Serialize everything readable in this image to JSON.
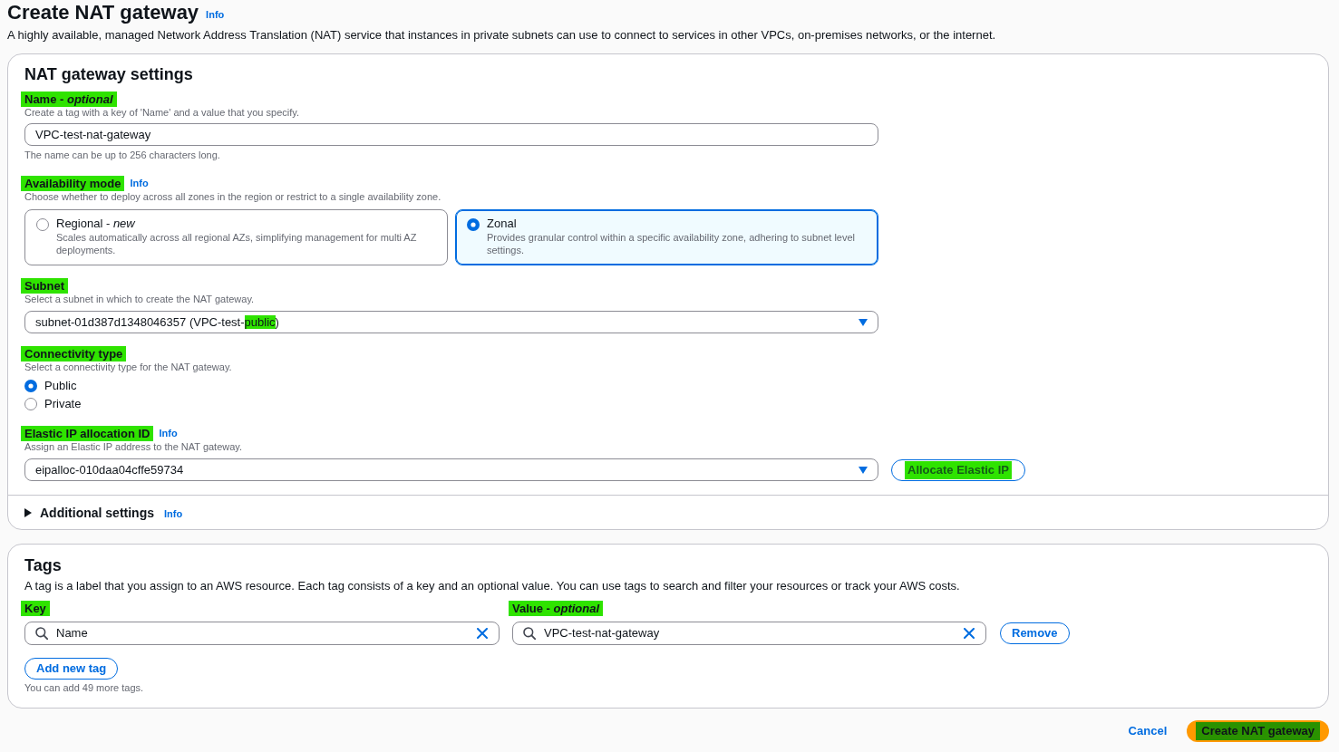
{
  "page": {
    "title": "Create NAT gateway",
    "info": "Info",
    "description": "A highly available, managed Network Address Translation (NAT) service that instances in private subnets can use to connect to services in other VPCs, on-premises networks, or the internet."
  },
  "settings": {
    "title": "NAT gateway settings",
    "name_field": {
      "label": "Name - *optional*",
      "highlighted": true,
      "description": "Create a tag with a key of 'Name' and a value that you specify.",
      "value": "VPC-test-nat-gateway",
      "constraint": "The name can be up to 256 characters long."
    },
    "availability_mode": {
      "label": "Availability mode",
      "highlighted": true,
      "info": "Info",
      "description": "Choose whether to deploy across all zones in the region or restrict to a single availability zone.",
      "options": [
        {
          "title": "Regional - *new*",
          "description": "Scales automatically across all regional AZs, simplifying management for multi AZ deployments.",
          "selected": false
        },
        {
          "title": "Zonal",
          "description": "Provides granular control within a specific availability zone, adhering to subnet level settings.",
          "selected": true
        }
      ]
    },
    "subnet": {
      "label": "Subnet",
      "highlighted": true,
      "description": "Select a subnet in which to create the NAT gateway.",
      "value_parts": [
        {
          "text": "subnet-01d387d1348046357 (VPC-test-",
          "highlighted": false
        },
        {
          "text": "public",
          "highlighted": true
        },
        {
          "text": ")",
          "highlighted": false
        }
      ]
    },
    "connectivity_type": {
      "label": "Connectivity type",
      "highlighted": true,
      "description": "Select a connectivity type for the NAT gateway.",
      "options": [
        {
          "label": "Public",
          "selected": true
        },
        {
          "label": "Private",
          "selected": false
        }
      ]
    },
    "elastic_ip": {
      "label": "Elastic IP allocation ID",
      "highlighted": true,
      "info": "Info",
      "description": "Assign an Elastic IP address to the NAT gateway.",
      "value": "eipalloc-010daa04cffe59734",
      "button": {
        "label": "Allocate Elastic IP",
        "highlighted": true
      }
    },
    "additional_settings": {
      "label": "Additional settings",
      "info": "Info",
      "expanded": false
    }
  },
  "tags": {
    "title": "Tags",
    "description": "A tag is a label that you assign to an AWS resource. Each tag consists of a key and an optional value. You can use tags to search and filter your resources or track your AWS costs.",
    "columns": [
      {
        "label": "Key",
        "highlighted": true
      },
      {
        "label": "Value - *optional*",
        "highlighted": true
      }
    ],
    "rows": [
      {
        "key": "Name",
        "value": "VPC-test-nat-gateway",
        "remove": "Remove"
      }
    ],
    "add_button": "Add new tag",
    "limit_note": "You can add 49 more tags."
  },
  "footer": {
    "cancel": "Cancel",
    "submit": {
      "label": "Create NAT gateway",
      "highlighted": true
    }
  }
}
